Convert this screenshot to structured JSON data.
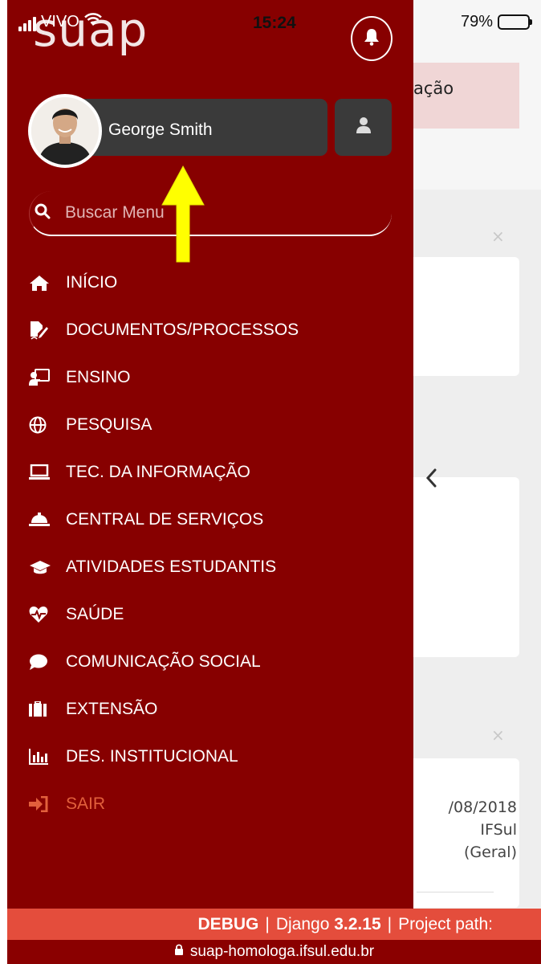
{
  "status_bar": {
    "carrier": "VIVO",
    "time": "15:24",
    "battery": "79%",
    "battery_level": 0.79
  },
  "background_page": {
    "alert_text": "ação",
    "close_symbol": "×",
    "card_lines": [
      "/08/2018",
      "IFSul",
      "(Geral)"
    ]
  },
  "drawer": {
    "logo": "suap",
    "user_name": "George Smith",
    "search_placeholder": "Buscar Menu",
    "menu": [
      {
        "label": "INÍCIO",
        "icon": "home-icon"
      },
      {
        "label": "DOCUMENTOS/PROCESSOS",
        "icon": "file-signature-icon"
      },
      {
        "label": "ENSINO",
        "icon": "chalkboard-teacher-icon"
      },
      {
        "label": "PESQUISA",
        "icon": "globe-icon"
      },
      {
        "label": "TEC. DA INFORMAÇÃO",
        "icon": "laptop-icon"
      },
      {
        "label": "CENTRAL DE SERVIÇOS",
        "icon": "concierge-bell-icon"
      },
      {
        "label": "ATIVIDADES ESTUDANTIS",
        "icon": "graduation-cap-icon"
      },
      {
        "label": "SAÚDE",
        "icon": "heartbeat-icon"
      },
      {
        "label": "COMUNICAÇÃO SOCIAL",
        "icon": "comment-icon"
      },
      {
        "label": "EXTENSÃO",
        "icon": "suitcase-icon"
      },
      {
        "label": "DES. INSTITUCIONAL",
        "icon": "chart-bar-icon"
      },
      {
        "label": "SAIR",
        "icon": "sign-out-icon"
      }
    ]
  },
  "debug_bar": {
    "label": "DEBUG",
    "separator": "|",
    "framework": "Django",
    "version": "3.2.15",
    "path_label": "Project path:"
  },
  "url_bar": {
    "url": "suap-homologa.ifsul.edu.br"
  },
  "colors": {
    "drawer_bg": "#870000",
    "debug_bg": "#e44d3c",
    "logout": "#e2603c",
    "arrow": "#ffff00"
  }
}
